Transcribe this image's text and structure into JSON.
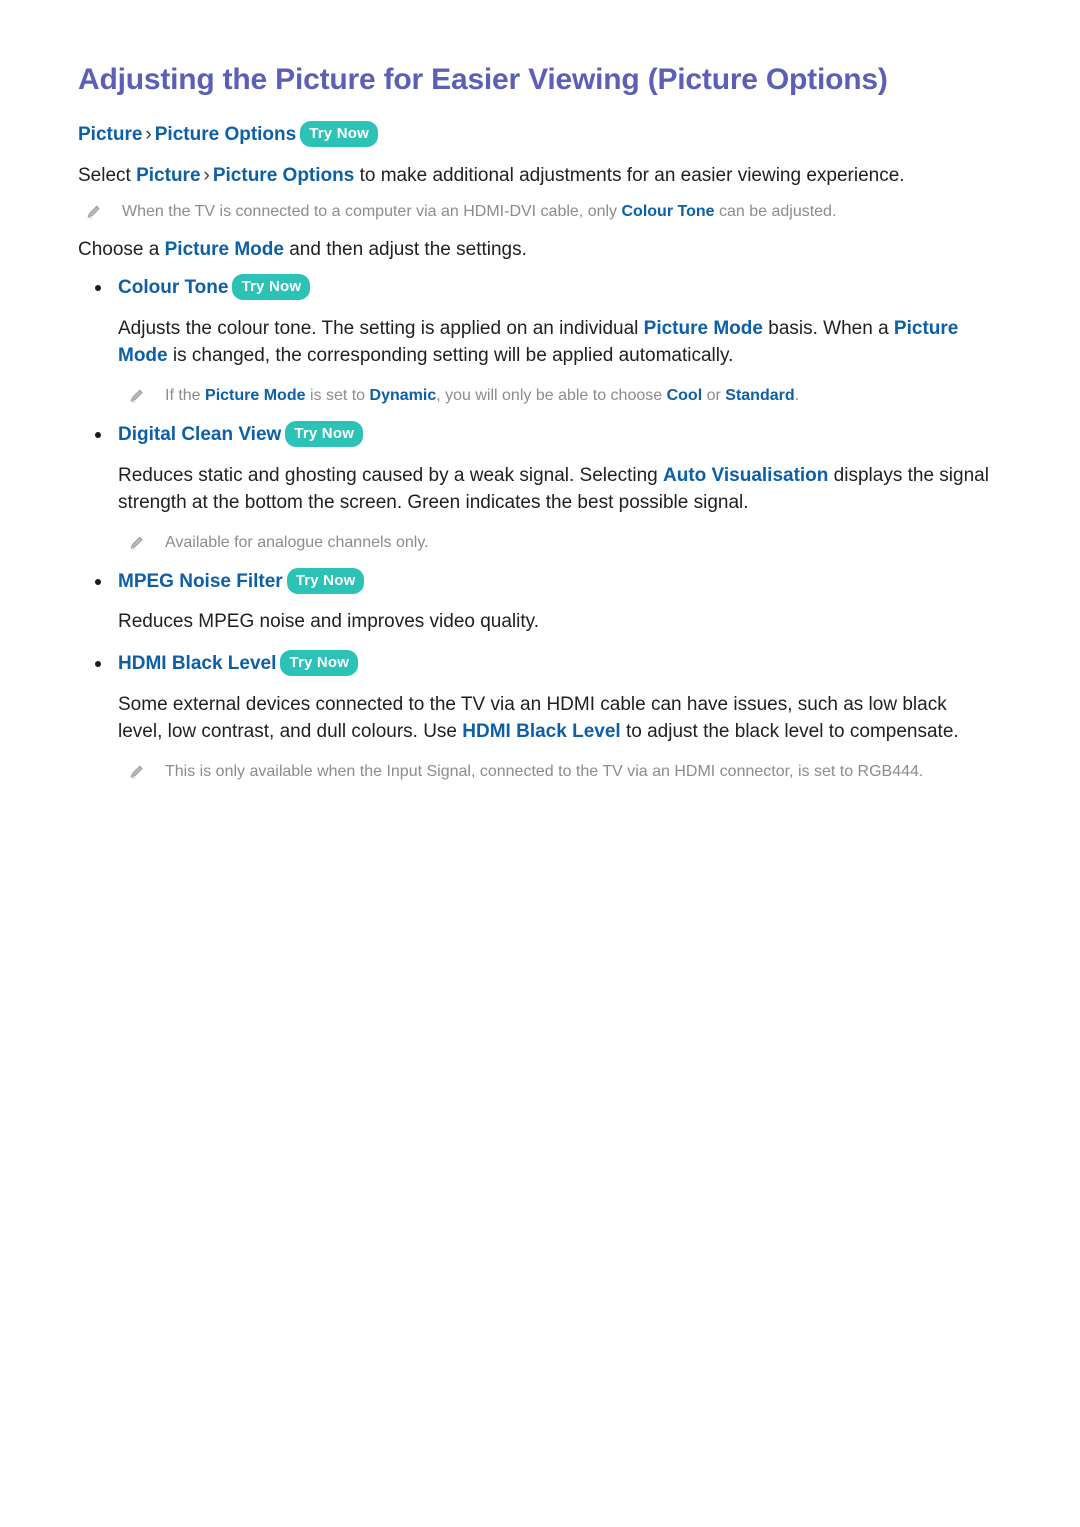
{
  "colors": {
    "title": "#5b5fb5",
    "link": "#0d5fa6",
    "body": "#1f1f1f",
    "note": "#8c8c8c",
    "badge_bg": "#2cc2b6",
    "badge_text": "#ffffff",
    "background": "#ffffff"
  },
  "badge": {
    "label": "Try Now"
  },
  "icons": {
    "pencil": "pencil-icon",
    "bullet": "bullet-dot-icon",
    "chevron": "chevron-right-separator"
  },
  "document": {
    "title": "Adjusting the Picture for Easier Viewing (Picture Options)",
    "breadcrumb": {
      "items": [
        "Picture",
        "Picture Options"
      ],
      "separator": "›",
      "badge": "Try Now"
    },
    "intro": {
      "lead": "Select ",
      "kw1": "Picture",
      "separator": "›",
      "kw2": "Picture Options",
      "tail": " to make additional adjustments for an easier viewing experience."
    },
    "intro_note": {
      "part1": "When the TV is connected to a computer via an HDMI-DVI cable, only ",
      "kw1": "Colour Tone",
      "part2": " can be adjusted."
    },
    "choose_line": {
      "part1": "Choose a ",
      "kw1": "Picture Mode",
      "part2": " and then adjust the settings."
    },
    "sections": [
      {
        "id": "colour-tone",
        "heading": "Colour Tone",
        "badge": "Try Now",
        "body": {
          "part1": "Adjusts the colour tone. The setting is applied on an individual ",
          "kw1": "Picture Mode",
          "part2": " basis. When a ",
          "kw2": "Picture Mode",
          "part3": " is changed, the corresponding setting will be applied automatically."
        },
        "note": {
          "part1": "If the ",
          "kw1": "Picture Mode",
          "part2": " is set to ",
          "kw2": "Dynamic",
          "part3": ", you will only be able to choose ",
          "kw3": "Cool",
          "part4": " or ",
          "kw4": "Standard",
          "part5": "."
        }
      },
      {
        "id": "digital-clean-view",
        "heading": "Digital Clean View",
        "badge": "Try Now",
        "body": {
          "part1": "Reduces static and ghosting caused by a weak signal. Selecting ",
          "kw1": "Auto Visualisation",
          "part2": " displays the signal strength at the bottom the screen. Green indicates the best possible signal."
        },
        "note": {
          "part1": "Available for analogue channels only."
        }
      },
      {
        "id": "mpeg-noise-filter",
        "heading": "MPEG Noise Filter",
        "badge": "Try Now",
        "body": {
          "part1": "Reduces MPEG noise and improves video quality."
        }
      },
      {
        "id": "hdmi-black-level",
        "heading": "HDMI Black Level",
        "badge": "Try Now",
        "body": {
          "part1": "Some external devices connected to the TV via an HDMI cable can have issues, such as low black level, low contrast, and dull colours. Use ",
          "kw1": "HDMI Black Level",
          "part2": " to adjust the black level to compensate."
        },
        "note": {
          "part1": "This is only available when the Input Signal, connected to the TV via an HDMI connector, is set to RGB444."
        }
      }
    ]
  }
}
